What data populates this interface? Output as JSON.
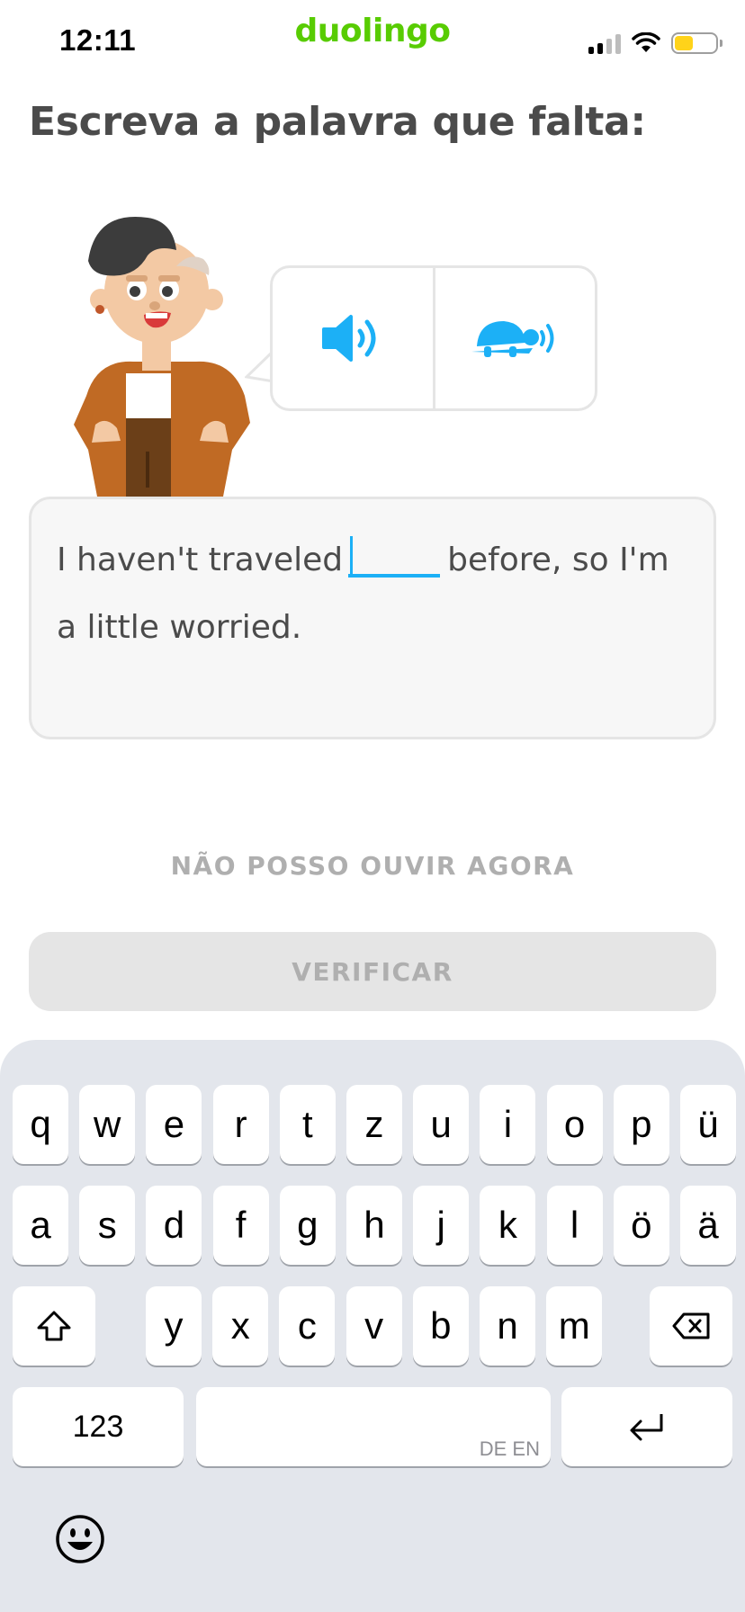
{
  "status_bar": {
    "time": "12:11",
    "brand": "duolingo"
  },
  "prompt": {
    "title": "Escreva a palavra que falta:"
  },
  "sentence": {
    "before": "I haven't traveled",
    "after": "before, so I'm a little worried."
  },
  "buttons": {
    "cant_listen": "NÃO POSSO OUVIR AGORA",
    "check": "VERIFICAR"
  },
  "keyboard": {
    "row1": [
      "q",
      "w",
      "e",
      "r",
      "t",
      "z",
      "u",
      "i",
      "o",
      "p",
      "ü"
    ],
    "row2": [
      "a",
      "s",
      "d",
      "f",
      "g",
      "h",
      "j",
      "k",
      "l",
      "ö",
      "ä"
    ],
    "row3": [
      "y",
      "x",
      "c",
      "v",
      "b",
      "n",
      "m"
    ],
    "numbers_label": "123",
    "space_hint": "DE EN"
  },
  "colors": {
    "brand": "#58cc02",
    "accent": "#1cb0f6",
    "disabled": "#afafaf"
  },
  "icons": [
    "speaker-icon",
    "turtle-icon",
    "shift-icon",
    "backspace-icon",
    "return-icon",
    "emoji-icon"
  ]
}
